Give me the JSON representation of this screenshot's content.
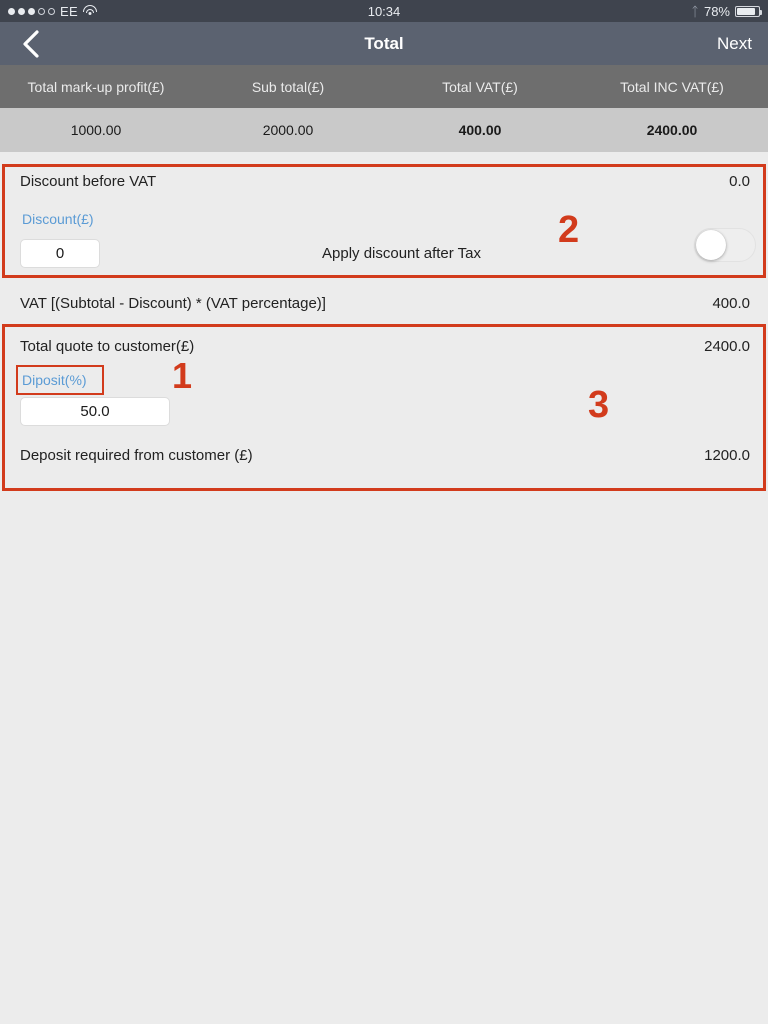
{
  "status_bar": {
    "signal_dots_filled": 3,
    "signal_dots_total": 5,
    "carrier": "EE",
    "wifi_icon": "wifi-icon",
    "time": "10:34",
    "bluetooth_icon": "bluetooth-icon",
    "battery_percent": "78%",
    "battery_icon": "battery-icon"
  },
  "nav": {
    "back_icon": "chevron-left-icon",
    "title": "Total",
    "next_label": "Next"
  },
  "summary_table": {
    "headers": [
      "Total mark-up profit(£)",
      "Sub total(£)",
      "Total VAT(£)",
      "Total INC VAT(£)"
    ],
    "values": [
      "1000.00",
      "2000.00",
      "400.00",
      "2400.00"
    ]
  },
  "discount_section": {
    "title": "Discount before VAT",
    "title_value": "0.0",
    "field_label": "Discount(£)",
    "field_value": "0",
    "toggle_label": "Apply discount after Tax",
    "toggle_state": "off"
  },
  "vat_row": {
    "label": "VAT [(Subtotal - Discount) * (VAT percentage)]",
    "value": "400.0"
  },
  "deposit_section": {
    "quote_label": "Total quote to customer(£)",
    "quote_value": "2400.0",
    "field_label": "Diposit(%)",
    "field_value": "50.0",
    "deposit_label": "Deposit required from customer (£)",
    "deposit_value": "1200.0"
  },
  "annotations": {
    "color": "#d23b1c",
    "markers": [
      {
        "id": "1",
        "text": "1"
      },
      {
        "id": "2",
        "text": "2"
      },
      {
        "id": "3",
        "text": "3"
      }
    ]
  },
  "colors": {
    "status_bar_bg": "#3f444e",
    "nav_bar_bg": "#5b6270",
    "table_header_bg": "#6e6e6e",
    "table_row_bg": "#c9c9c9",
    "page_bg": "#ececec",
    "field_label_blue": "#5b9bd5",
    "annotation_red": "#d23b1c"
  }
}
